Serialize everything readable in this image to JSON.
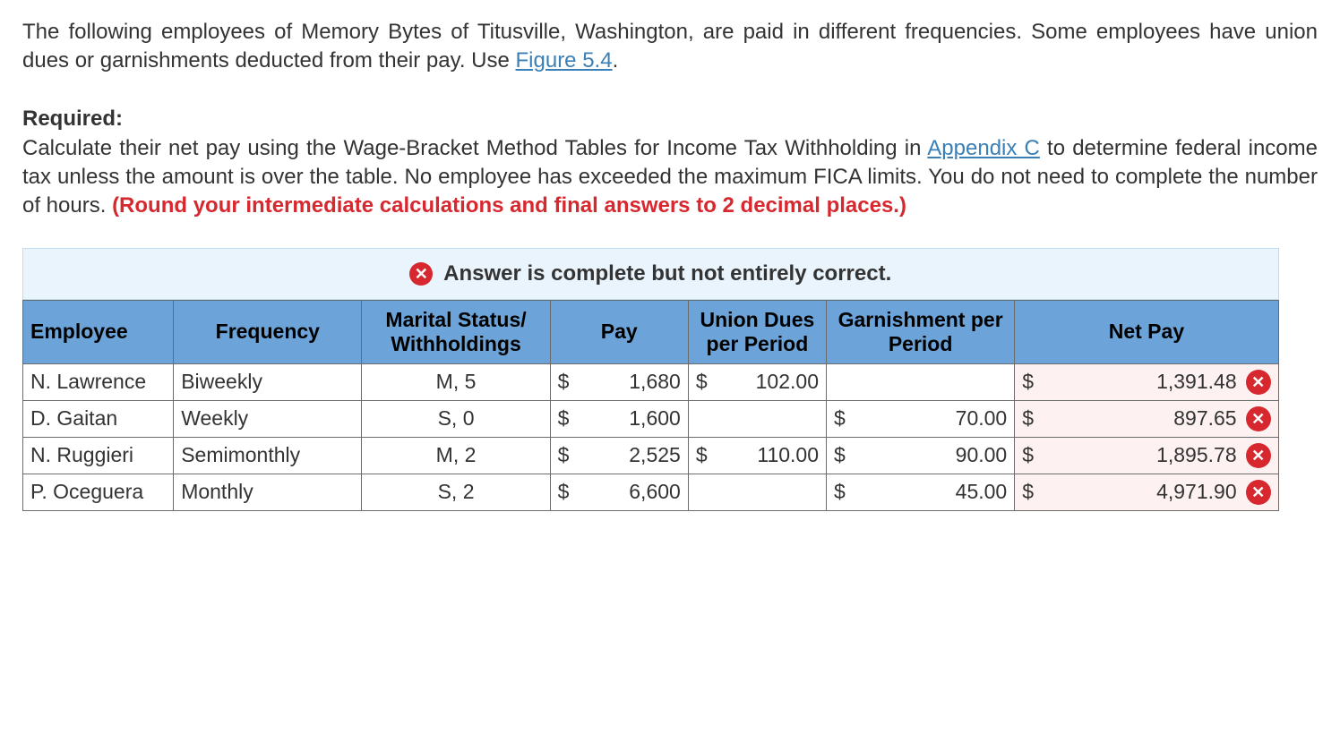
{
  "prompt": {
    "p1a": "The following employees of Memory Bytes of Titusville, Washington, are paid in different frequencies. Some employees have union dues or garnishments deducted from their pay. Use ",
    "link1": "Figure 5.4",
    "p1b": ".",
    "required_label": "Required:",
    "p2a": "Calculate their net pay using the Wage-Bracket Method Tables for Income Tax Withholding in ",
    "link2": "Appendix C",
    "p2b": " to determine federal income tax unless the amount is over the table. No employee has exceeded the maximum FICA limits. You do not need to complete the number of hours. ",
    "round_note": "(Round your intermediate calculations and final answers to 2 decimal places.)"
  },
  "feedback": "Answer is complete but not entirely correct.",
  "columns": {
    "employee": "Employee",
    "frequency": "Frequency",
    "marital": "Marital Status/ Withholdings",
    "pay": "Pay",
    "union": "Union Dues per Period",
    "garnish": "Garnishment per Period",
    "net": "Net Pay"
  },
  "rows": [
    {
      "employee": "N. Lawrence",
      "frequency": "Biweekly",
      "marital": "M, 5",
      "pay": "1,680",
      "union": "102.00",
      "garnish": "",
      "net": "1,391.48",
      "net_status": "wrong"
    },
    {
      "employee": "D. Gaitan",
      "frequency": "Weekly",
      "marital": "S, 0",
      "pay": "1,600",
      "union": "",
      "garnish": "70.00",
      "net": "897.65",
      "net_status": "wrong"
    },
    {
      "employee": "N. Ruggieri",
      "frequency": "Semimonthly",
      "marital": "M, 2",
      "pay": "2,525",
      "union": "110.00",
      "garnish": "90.00",
      "net": "1,895.78",
      "net_status": "wrong"
    },
    {
      "employee": "P. Oceguera",
      "frequency": "Monthly",
      "marital": "S, 2",
      "pay": "6,600",
      "union": "",
      "garnish": "45.00",
      "net": "4,971.90",
      "net_status": "wrong"
    }
  ]
}
